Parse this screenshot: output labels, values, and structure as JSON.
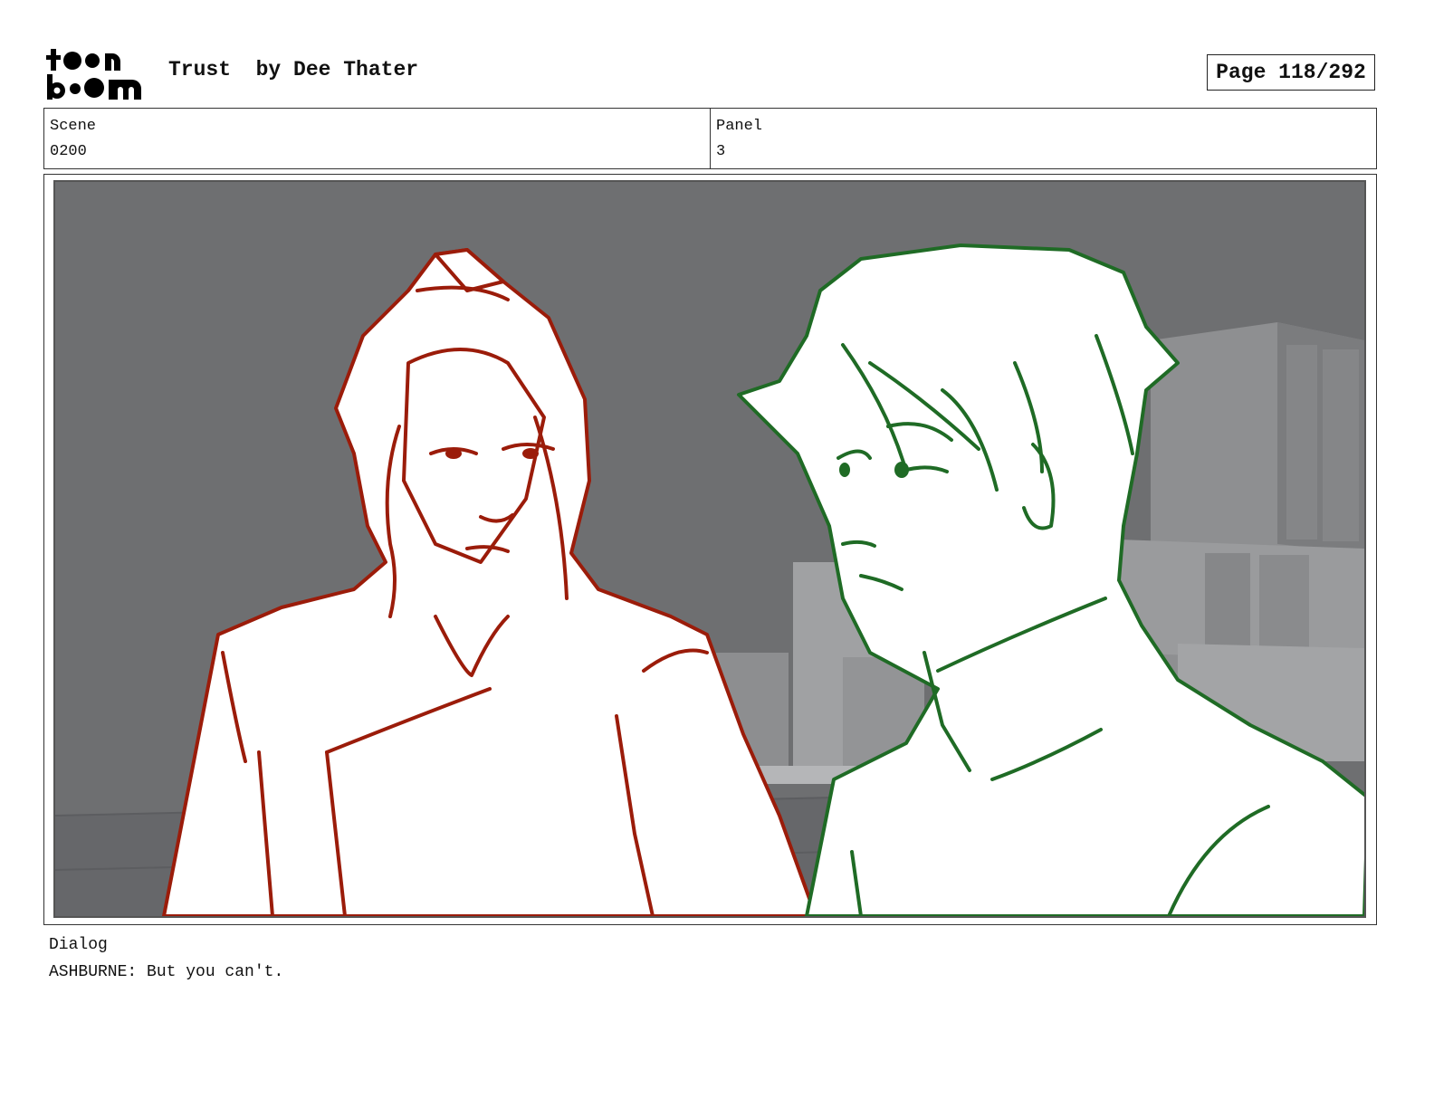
{
  "header": {
    "logo_text_top": "toon",
    "logo_text_bottom": "boom",
    "title": "Trust  by Dee Thater",
    "page_label": "Page 118/292"
  },
  "meta": {
    "scene_label": "Scene",
    "scene_value": "0200",
    "panel_label": "Panel",
    "panel_value": "3"
  },
  "dialog": {
    "label": "Dialog",
    "text": "ASHBURNE: But you can't."
  },
  "colors": {
    "left_character_line": "#9b1c0a",
    "right_character_line": "#1f6b25",
    "background": "#6e6f71"
  }
}
